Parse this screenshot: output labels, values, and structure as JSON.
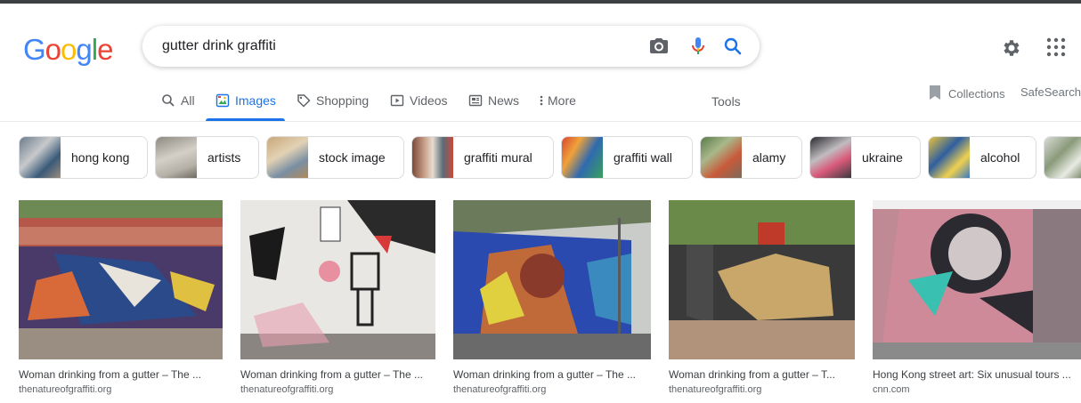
{
  "logo": {
    "letters": [
      "G",
      "o",
      "o",
      "g",
      "l",
      "e"
    ],
    "colors": [
      "#4285F4",
      "#EA4335",
      "#FBBC05",
      "#4285F4",
      "#34A853",
      "#EA4335"
    ]
  },
  "search": {
    "query": "gutter drink graffiti"
  },
  "tabs": [
    {
      "label": "All",
      "icon": "search-icon"
    },
    {
      "label": "Images",
      "icon": "image-icon",
      "active": true
    },
    {
      "label": "Shopping",
      "icon": "tag-icon"
    },
    {
      "label": "Videos",
      "icon": "play-icon"
    },
    {
      "label": "News",
      "icon": "news-icon"
    },
    {
      "label": "More",
      "icon": "more-vert-icon"
    }
  ],
  "tools_label": "Tools",
  "collections_label": "Collections",
  "safesearch_label": "SafeSearch",
  "chips": [
    {
      "label": "hong kong"
    },
    {
      "label": "artists"
    },
    {
      "label": "stock image"
    },
    {
      "label": "graffiti mural"
    },
    {
      "label": "graffiti wall"
    },
    {
      "label": "alamy"
    },
    {
      "label": "ukraine"
    },
    {
      "label": "alcohol"
    }
  ],
  "results": [
    {
      "title": "Woman drinking from a gutter – The ...",
      "source": "thenatureofgraffiti.org"
    },
    {
      "title": "Woman drinking from a gutter – The ...",
      "source": "thenatureofgraffiti.org"
    },
    {
      "title": "Woman drinking from a gutter – The ...",
      "source": "thenatureofgraffiti.org"
    },
    {
      "title": "Woman drinking from a gutter – T...",
      "source": "thenatureofgraffiti.org"
    },
    {
      "title": "Hong Kong street art: Six unusual tours ...",
      "source": "cnn.com"
    }
  ],
  "colors": {
    "accent": "#1a73e8",
    "tab_text": "#5f6368"
  }
}
